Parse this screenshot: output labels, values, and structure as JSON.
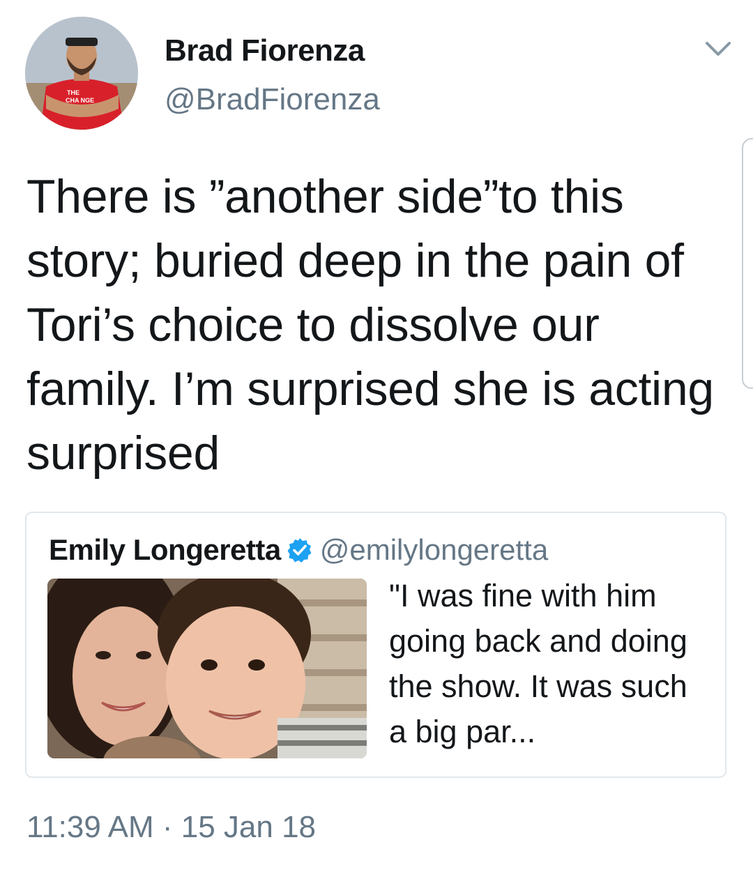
{
  "tweet": {
    "author": {
      "name": "Brad Fiorenza",
      "handle": "@BradFiorenza"
    },
    "text": "There is ”another side”to this story; buried deep in the pain of Tori’s choice to dissolve our family. I’m surprised she is acting surprised",
    "timestamp": "11:39 AM · 15 Jan 18"
  },
  "quoted_tweet": {
    "author": {
      "name": "Emily Longeretta",
      "handle": "@emilylongeretta",
      "verified": true
    },
    "text": "\"I was fine with him going back and doing the show. It was such a big par..."
  },
  "colors": {
    "text_primary": "#14171a",
    "text_secondary": "#657786",
    "verified_blue": "#1da1f2",
    "border": "#e1e8ed"
  },
  "icons": {
    "more": "chevron-down-icon",
    "verified": "verified-badge-icon"
  }
}
